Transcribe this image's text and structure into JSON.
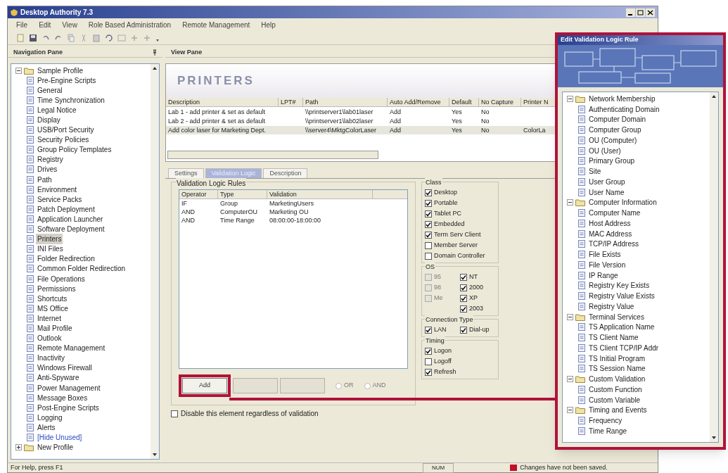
{
  "window": {
    "title": "Desktop Authority 7.3"
  },
  "menu": [
    "File",
    "Edit",
    "View",
    "Role Based Administration",
    "Remote Management",
    "Help"
  ],
  "navigation_pane": {
    "title": "Navigation Pane",
    "tree": [
      {
        "label": "Sample Profile",
        "expanded": true,
        "selected": false,
        "children": [
          {
            "label": "Pre-Engine Scripts",
            "selected": false
          },
          {
            "label": "General",
            "selected": false
          },
          {
            "label": "Time Synchronization",
            "selected": false
          },
          {
            "label": "Legal Notice",
            "selected": false
          },
          {
            "label": "Display",
            "selected": false
          },
          {
            "label": "USB/Port Security",
            "selected": false
          },
          {
            "label": "Security Policies",
            "selected": false
          },
          {
            "label": "Group Policy Templates",
            "selected": false
          },
          {
            "label": "Registry",
            "selected": false
          },
          {
            "label": "Drives",
            "selected": false
          },
          {
            "label": "Path",
            "selected": false
          },
          {
            "label": "Environment",
            "selected": false
          },
          {
            "label": "Service Packs",
            "selected": false
          },
          {
            "label": "Patch Deployment",
            "selected": false
          },
          {
            "label": "Application Launcher",
            "selected": false
          },
          {
            "label": "Software Deployment",
            "selected": false
          },
          {
            "label": "Printers",
            "selected": true
          },
          {
            "label": "INI Files",
            "selected": false
          },
          {
            "label": "Folder Redirection",
            "selected": false
          },
          {
            "label": "Common Folder Redirection",
            "selected": false
          },
          {
            "label": "File Operations",
            "selected": false
          },
          {
            "label": "Permissions",
            "selected": false
          },
          {
            "label": "Shortcuts",
            "selected": false
          },
          {
            "label": "MS Office",
            "selected": false
          },
          {
            "label": "Internet",
            "selected": false
          },
          {
            "label": "Mail Profile",
            "selected": false
          },
          {
            "label": "Outlook",
            "selected": false
          },
          {
            "label": "Remote Management",
            "selected": false
          },
          {
            "label": "Inactivity",
            "selected": false
          },
          {
            "label": "Windows Firewall",
            "selected": false
          },
          {
            "label": "Anti-Spyware",
            "selected": false
          },
          {
            "label": "Power Management",
            "selected": false
          },
          {
            "label": "Message Boxes",
            "selected": false
          },
          {
            "label": "Post-Engine Scripts",
            "selected": false
          },
          {
            "label": "Logging",
            "selected": false
          },
          {
            "label": "Alerts",
            "selected": false
          },
          {
            "label": "[Hide Unused]",
            "selected": false,
            "kind": "link"
          }
        ]
      },
      {
        "label": "New Profile",
        "expanded": false,
        "selected": false
      }
    ]
  },
  "view_pane": {
    "title": "View Pane",
    "heading": "PRINTERS",
    "table": {
      "columns": [
        "Description",
        "LPT#",
        "Path",
        "Auto Add/Remove",
        "Default",
        "No Capture",
        "Printer N"
      ],
      "rows": [
        {
          "cells": [
            "Lab 1 - add printer & set as default",
            "",
            "\\\\printserver1\\lab01laser",
            "Add",
            "Yes",
            "No",
            ""
          ],
          "selected": false
        },
        {
          "cells": [
            "Lab 2 - add printer & set as default",
            "",
            "\\\\printserver1\\lab02laser",
            "Add",
            "Yes",
            "No",
            ""
          ],
          "selected": false
        },
        {
          "cells": [
            "Add color laser for Marketing Dept.",
            "",
            "\\\\server4\\MktgColorLaser",
            "Add",
            "Yes",
            "No",
            "ColorLa"
          ],
          "selected": true
        }
      ]
    },
    "tabs": [
      {
        "label": "Settings",
        "selected": false
      },
      {
        "label": "Validation Logic",
        "selected": true
      },
      {
        "label": "Description",
        "selected": false
      }
    ],
    "rules": {
      "title": "Validation Logic Rules",
      "columns": [
        "Operator",
        "Type",
        "Validation"
      ],
      "rows": [
        [
          "IF",
          "Group",
          "MarketingUsers"
        ],
        [
          "AND",
          "ComputerOU",
          "Marketing OU"
        ],
        [
          "AND",
          "Time Range",
          "08:00:00-18:00:00"
        ]
      ],
      "buttons": [
        {
          "label": "Add",
          "disabled": false
        },
        {
          "disabled": true
        },
        {
          "disabled": true
        }
      ],
      "radios": [
        {
          "label": "OR",
          "selected": false
        },
        {
          "label": "AND",
          "selected": false
        }
      ]
    },
    "groups": [
      {
        "title": "Class",
        "items": [
          {
            "label": "Desktop",
            "checked": true,
            "disabled": false
          },
          {
            "label": "Portable",
            "checked": true,
            "disabled": false
          },
          {
            "label": "Tablet PC",
            "checked": true,
            "disabled": false
          },
          {
            "label": "Embedded",
            "checked": true,
            "disabled": false
          },
          {
            "label": "Term Serv Client",
            "checked": true,
            "disabled": false
          },
          {
            "label": "Member Server",
            "checked": false,
            "disabled": false
          },
          {
            "label": "Domain Controller",
            "checked": false,
            "disabled": false
          }
        ]
      },
      {
        "title": "OS",
        "items": [
          {
            "label": "95",
            "checked": false,
            "disabled": true
          },
          {
            "label": "NT",
            "checked": true,
            "disabled": false
          },
          {
            "label": "98",
            "checked": false,
            "disabled": true
          },
          {
            "label": "2000",
            "checked": true,
            "disabled": false
          },
          {
            "label": "Me",
            "checked": false,
            "disabled": true
          },
          {
            "label": "XP",
            "checked": true,
            "disabled": false
          },
          {
            "label": "2003",
            "checked": true,
            "disabled": false
          }
        ]
      },
      {
        "title": "Connection Type",
        "items": [
          {
            "label": "LAN",
            "checked": true,
            "disabled": false
          },
          {
            "label": "Dial-up",
            "checked": true,
            "disabled": false
          }
        ]
      },
      {
        "title": "Timing",
        "items": [
          {
            "label": "Logon",
            "checked": true,
            "disabled": false
          },
          {
            "label": "Logoff",
            "checked": false,
            "disabled": false
          },
          {
            "label": "Refresh",
            "checked": true,
            "disabled": false
          }
        ]
      }
    ],
    "disable_checkbox": {
      "label": "Disable this element regardless of validation",
      "checked": false
    }
  },
  "status_bar": {
    "help": "For Help, press F1",
    "num": "NUM",
    "message": "Changes have not been saved."
  },
  "callout": {
    "title": "Edit Validation Logic Rule",
    "tree": [
      {
        "label": "Network Membership",
        "expanded": true,
        "children": [
          {
            "label": "Authenticating Domain"
          },
          {
            "label": "Computer Domain"
          },
          {
            "label": "Computer Group"
          },
          {
            "label": "OU (Computer)"
          },
          {
            "label": "OU (User)"
          },
          {
            "label": "Primary Group"
          },
          {
            "label": "Site"
          },
          {
            "label": "User Group"
          },
          {
            "label": "User Name"
          }
        ]
      },
      {
        "label": "Computer Information",
        "expanded": true,
        "children": [
          {
            "label": "Computer Name"
          },
          {
            "label": "Host Address"
          },
          {
            "label": "MAC Address"
          },
          {
            "label": "TCP/IP Address"
          },
          {
            "label": "File Exists"
          },
          {
            "label": "File Version"
          },
          {
            "label": "IP Range"
          },
          {
            "label": "Registry Key Exists"
          },
          {
            "label": "Registry Value Exists"
          },
          {
            "label": "Registry Value"
          }
        ]
      },
      {
        "label": "Terminal Services",
        "expanded": true,
        "children": [
          {
            "label": "TS Application Name"
          },
          {
            "label": "TS Client Name"
          },
          {
            "label": "TS Client TCP/IP Addr"
          },
          {
            "label": "TS Initial Program"
          },
          {
            "label": "TS Session Name"
          }
        ]
      },
      {
        "label": "Custom Validation",
        "expanded": true,
        "children": [
          {
            "label": "Custom Function"
          },
          {
            "label": "Custom Variable"
          }
        ]
      },
      {
        "label": "Timing and Events",
        "expanded": true,
        "children": [
          {
            "label": "Frequency"
          },
          {
            "label": "Time Range"
          }
        ]
      }
    ]
  }
}
